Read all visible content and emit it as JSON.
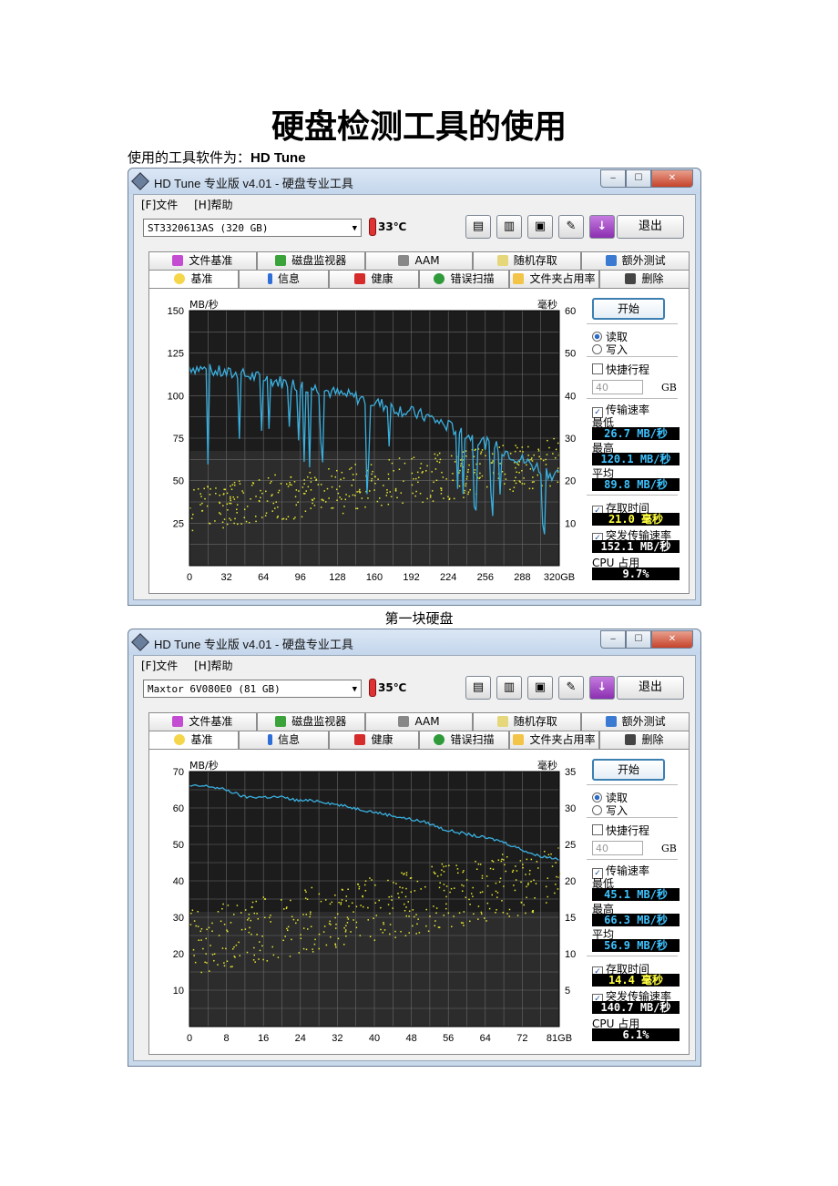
{
  "doc": {
    "title": "硬盘检测工具的使用",
    "intro_prefix": "使用的工具软件为：",
    "intro_tool": "HD Tune"
  },
  "windows": [
    {
      "title": "HD Tune 专业版 v4.01 - 硬盘专业工具",
      "menu": [
        "[F]文件",
        "[H]帮助"
      ],
      "drive": "ST3320613AS (320 GB)",
      "temperature": "33℃",
      "exit_label": "退出",
      "tabs_top": [
        "文件基准",
        "磁盘监视器",
        "AAM",
        "随机存取",
        "额外测试"
      ],
      "tabs_bottom": [
        "基准",
        "信息",
        "健康",
        "错误扫描",
        "文件夹占用率",
        "删除"
      ],
      "start_label": "开始",
      "read_label": "读取",
      "write_label": "写入",
      "short_stroke_label": "快捷行程",
      "stroke_value": "40",
      "stroke_unit": "GB",
      "transfer_label": "传输速率",
      "min_label": "最低",
      "min_value": "26.7 MB/秒",
      "max_label": "最高",
      "max_value": "120.1 MB/秒",
      "avg_label": "平均",
      "avg_value": "89.8 MB/秒",
      "access_label": "存取时间",
      "access_value": "21.0 毫秒",
      "burst_label": "突发传输速率",
      "burst_value": "152.1 MB/秒",
      "cpu_label": "CPU 占用",
      "cpu_value": "9.7%",
      "caption": "第一块硬盘"
    },
    {
      "title": "HD Tune 专业版 v4.01 - 硬盘专业工具",
      "menu": [
        "[F]文件",
        "[H]帮助"
      ],
      "drive": "Maxtor 6V080E0 (81 GB)",
      "temperature": "35℃",
      "exit_label": "退出",
      "tabs_top": [
        "文件基准",
        "磁盘监视器",
        "AAM",
        "随机存取",
        "额外测试"
      ],
      "tabs_bottom": [
        "基准",
        "信息",
        "健康",
        "错误扫描",
        "文件夹占用率",
        "删除"
      ],
      "start_label": "开始",
      "read_label": "读取",
      "write_label": "写入",
      "short_stroke_label": "快捷行程",
      "stroke_value": "40",
      "stroke_unit": "GB",
      "transfer_label": "传输速率",
      "min_label": "最低",
      "min_value": "45.1 MB/秒",
      "max_label": "最高",
      "max_value": "66.3 MB/秒",
      "avg_label": "平均",
      "avg_value": "56.9 MB/秒",
      "access_label": "存取时间",
      "access_value": "14.4 毫秒",
      "burst_label": "突发传输速率",
      "burst_value": "140.7 MB/秒",
      "cpu_label": "CPU 占用",
      "cpu_value": "6.1%",
      "caption": ""
    }
  ],
  "chart_data": [
    {
      "type": "line",
      "ylabel": "MB/秒",
      "y2label": "毫秒",
      "ylim": [
        0,
        150
      ],
      "y2lim": [
        0,
        60
      ],
      "yticks": [
        25,
        50,
        75,
        100,
        125,
        150
      ],
      "y2ticks": [
        10,
        20,
        30,
        40,
        50,
        60
      ],
      "xlim": [
        0,
        320
      ],
      "xticks": [
        "0",
        "32",
        "64",
        "96",
        "128",
        "160",
        "192",
        "224",
        "256",
        "288",
        "320GB"
      ],
      "series": [
        {
          "x": [
            0,
            16,
            32,
            48,
            64,
            80,
            96,
            112,
            128,
            144,
            160,
            176,
            192,
            208,
            224,
            240,
            256,
            272,
            288,
            304,
            320
          ],
          "values": [
            117,
            115,
            113,
            112,
            110,
            108,
            106,
            104,
            101,
            99,
            96,
            93,
            90,
            87,
            82,
            77,
            72,
            68,
            62,
            57,
            52
          ]
        }
      ],
      "access_scatter_range_ms": [
        5,
        30
      ],
      "grid": true
    },
    {
      "type": "line",
      "ylabel": "MB/秒",
      "y2label": "毫秒",
      "ylim": [
        0,
        70
      ],
      "y2lim": [
        0,
        35
      ],
      "yticks": [
        10,
        20,
        30,
        40,
        50,
        60,
        70
      ],
      "y2ticks": [
        5,
        10,
        15,
        20,
        25,
        30,
        35
      ],
      "xlim": [
        0,
        81
      ],
      "xticks": [
        "0",
        "8",
        "16",
        "24",
        "32",
        "40",
        "48",
        "56",
        "64",
        "72",
        "81GB"
      ],
      "series": [
        {
          "x": [
            0,
            4,
            8,
            12,
            16,
            20,
            24,
            28,
            32,
            36,
            40,
            44,
            48,
            52,
            56,
            60,
            64,
            68,
            72,
            76,
            81
          ],
          "values": [
            66,
            66,
            65,
            63,
            63,
            63,
            62,
            62,
            61,
            60,
            59,
            58,
            57,
            56,
            54,
            53,
            52,
            51,
            49,
            47,
            46
          ]
        }
      ],
      "access_scatter_range_ms": [
        5,
        25
      ],
      "grid": true
    }
  ]
}
